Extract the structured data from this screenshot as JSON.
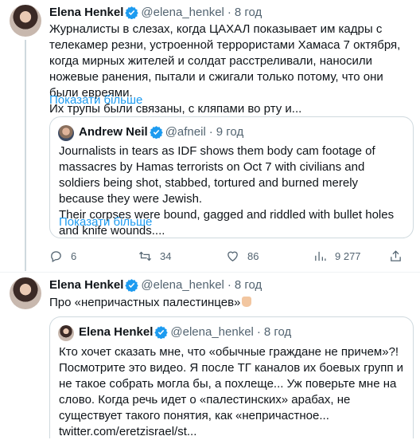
{
  "tweets": [
    {
      "author": "Elena Henkel",
      "handle": "@elena_henkel",
      "sep": "·",
      "time": "8 год",
      "text_lines": [
        "Журналисты в слезах, когда ЦАХАЛ показывает им кадры с телекамер резни, устроенной террористами Хамаса 7 октября, когда мирных жителей и солдат расстреливали, наносили ножевые ранения, пытали и сжигали только потому, что они были евреями.",
        "Их трупы были связаны, с кляпами во рту и..."
      ],
      "show_more": "Показати більше",
      "quote": {
        "author": "Andrew Neil",
        "handle": "@afneil",
        "sep": "·",
        "time": "9 год",
        "text_lines": [
          "Journalists in tears as IDF shows them body cam footage of massacres by Hamas terrorists on Oct 7 with civilians and soldiers being shot, stabbed, tortured and burned merely because they were Jewish.",
          "Their corpses were bound, gagged and riddled with bullet holes and knife wounds...."
        ],
        "show_more": "Показати більше"
      },
      "actions": {
        "replies": "6",
        "retweets": "34",
        "likes": "86",
        "views": "9 277"
      }
    },
    {
      "author": "Elena Henkel",
      "handle": "@elena_henkel",
      "sep": "·",
      "time": "8 год",
      "text": "Про «непричастных палестинцев»",
      "quote": {
        "author": "Elena Henkel",
        "handle": "@elena_henkel",
        "sep": "·",
        "time": "8 год",
        "text": "Кто хочет сказать мне, что «обычные граждане не причем»?! Посмотрите это видео. Я после ТГ каналов их боевых групп и не такое собрать могла бы, а похлеще... Уж поверьте мне на слово. Когда речь идет о «палестинских» арабах, не существует такого понятия, как «непричастное... twitter.com/eretzisrael/st..."
      }
    }
  ],
  "colors": {
    "link": "#1d9bf0",
    "muted": "#536471",
    "border": "#cfd9de"
  },
  "icons": [
    "verified-badge-icon",
    "reply-icon",
    "retweet-icon",
    "like-icon",
    "views-icon",
    "share-icon",
    "pointing-hand-emoji"
  ]
}
